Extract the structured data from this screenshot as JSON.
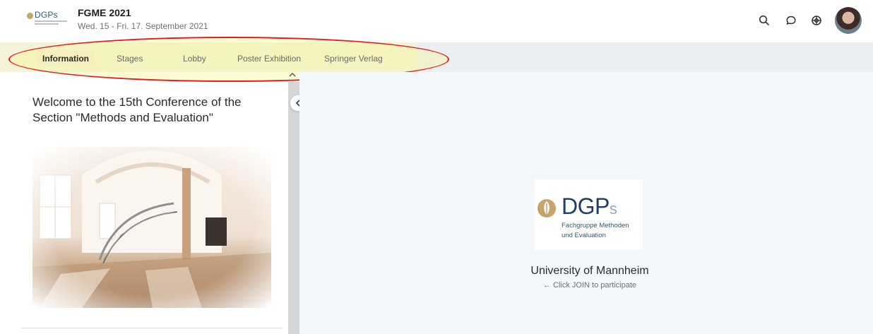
{
  "header": {
    "logo_text": "DGPs",
    "event_title": "FGME 2021",
    "event_date": "Wed. 15 - Fri. 17. September 2021",
    "icons": [
      "search-icon",
      "chat-icon",
      "help-icon",
      "avatar"
    ]
  },
  "nav": {
    "tabs": [
      {
        "label": "Information",
        "active": true
      },
      {
        "label": "Stages",
        "active": false
      },
      {
        "label": "Lobby",
        "active": false
      },
      {
        "label": "Poster Exhibition",
        "active": false
      },
      {
        "label": "Springer Verlag",
        "active": false
      }
    ]
  },
  "left_panel": {
    "welcome_title": "Welcome to the 15th Conference of the Section \"Methods and Evaluation\""
  },
  "right_panel": {
    "org_logo_main": "DGP",
    "org_logo_suffix": "s",
    "org_logo_line1": "Fachgruppe Methoden",
    "org_logo_line2": "und Evaluation",
    "venue": "University of Mannheim",
    "join_hint": "← Click JOIN to participate"
  },
  "colors": {
    "accent_highlight": "#f4f0bd",
    "annotation_red": "#e02020",
    "brand_navy": "#1e3f63",
    "brand_gold": "#c7a56a"
  }
}
